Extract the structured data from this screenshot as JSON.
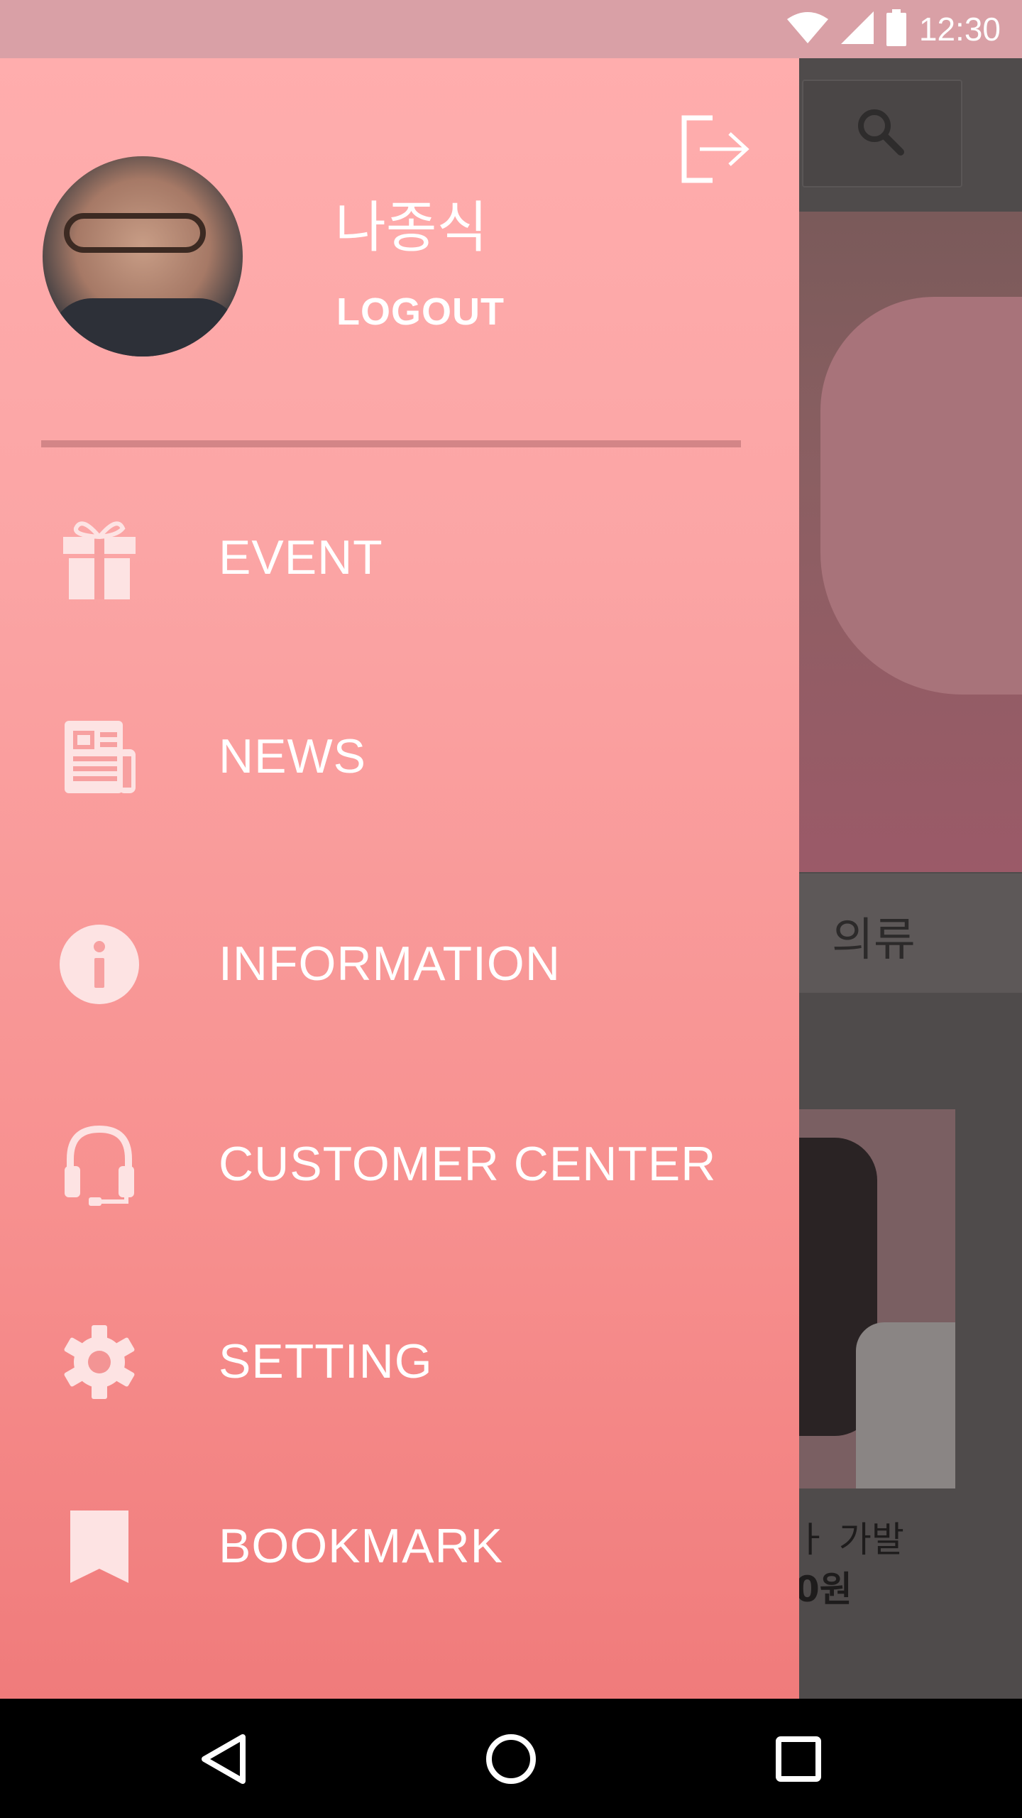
{
  "status_bar": {
    "time": "12:30",
    "icons": [
      "wifi-icon",
      "signal-icon",
      "battery-icon"
    ]
  },
  "background_app": {
    "search_icon": "search-icon",
    "tab_label": "의류",
    "product_name": "ㅏ 가발",
    "product_price": "0원"
  },
  "drawer": {
    "user_name": "나종식",
    "logout_label": "LOGOUT",
    "logout_icon": "logout-icon",
    "menu": [
      {
        "id": "event",
        "label": "EVENT",
        "icon": "gift-icon"
      },
      {
        "id": "news",
        "label": "NEWS",
        "icon": "newspaper-icon"
      },
      {
        "id": "information",
        "label": "INFORMATION",
        "icon": "info-icon"
      },
      {
        "id": "customer-center",
        "label": "CUSTOMER CENTER",
        "icon": "headset-icon"
      },
      {
        "id": "setting",
        "label": "SETTING",
        "icon": "gear-icon"
      },
      {
        "id": "bookmark",
        "label": "BOOKMARK",
        "icon": "bookmark-icon"
      }
    ]
  },
  "nav_bar": {
    "buttons": [
      "back-icon",
      "home-icon",
      "recents-icon"
    ]
  },
  "colors": {
    "drawer_top": "#ffadad",
    "drawer_bottom": "#f07b7b",
    "icon_tint": "#fde3e3",
    "status_bar": "#d9a0a6"
  }
}
